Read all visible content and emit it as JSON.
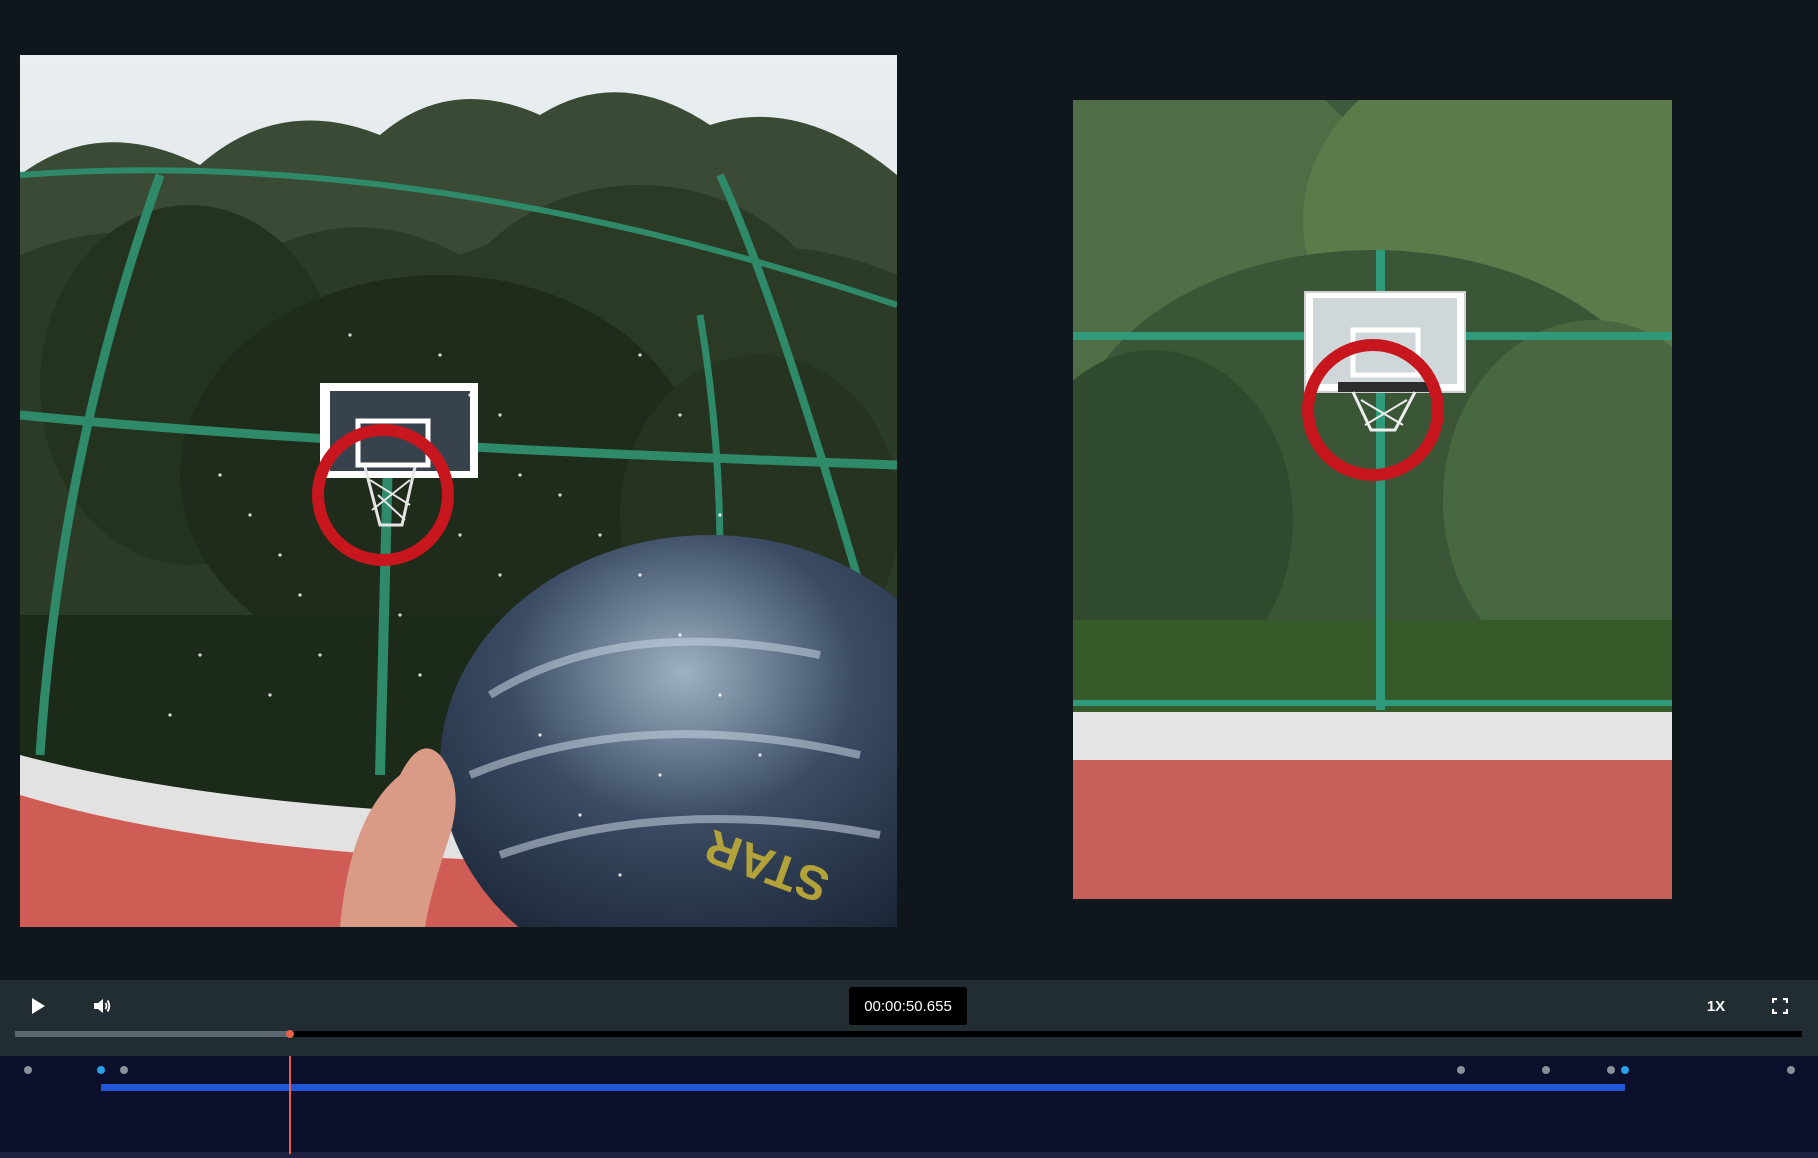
{
  "player": {
    "time": "00:00:50.655",
    "speed": "1X",
    "progress_fraction": 0.154
  },
  "timeline": {
    "playhead_fraction": 0.154,
    "markers": [
      {
        "color": "grey",
        "position_fraction": 0.007
      },
      {
        "color": "blue",
        "position_fraction": 0.048
      },
      {
        "color": "grey",
        "position_fraction": 0.061
      },
      {
        "color": "grey",
        "position_fraction": 0.809
      },
      {
        "color": "grey",
        "position_fraction": 0.857
      },
      {
        "color": "grey",
        "position_fraction": 0.893
      },
      {
        "color": "blue",
        "position_fraction": 0.901
      },
      {
        "color": "grey",
        "position_fraction": 0.994
      }
    ],
    "segment": {
      "start_fraction": 0.048,
      "end_fraction": 0.901,
      "color": "#1f57d6"
    }
  },
  "colors": {
    "background": "#0f171d",
    "controls_bar": "#222c33",
    "timeline_bg": "#0c0f2b",
    "accent": "#e8604a",
    "marker_blue": "#2aa0e6"
  },
  "icons": {
    "play": "play-icon",
    "volume": "volume-icon",
    "fullscreen": "fullscreen-icon"
  }
}
